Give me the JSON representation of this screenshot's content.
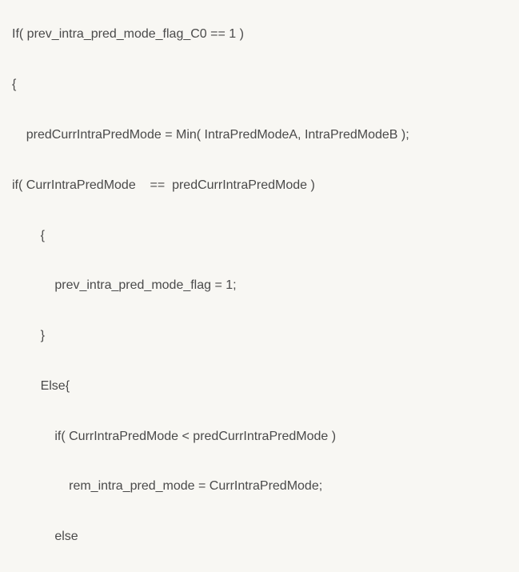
{
  "code": {
    "lines": [
      "If( prev_intra_pred_mode_flag_C0 == 1 )",
      "{",
      "    predCurrIntraPredMode = Min( IntraPredModeA, IntraPredModeB );",
      "if( CurrIntraPredMode    ==  predCurrIntraPredMode )",
      "        {",
      "            prev_intra_pred_mode_flag = 1;",
      "        }",
      "        Else{",
      "            if( CurrIntraPredMode < predCurrIntraPredMode )",
      "                rem_intra_pred_mode = CurrIntraPredMode;",
      "            else"
    ]
  }
}
